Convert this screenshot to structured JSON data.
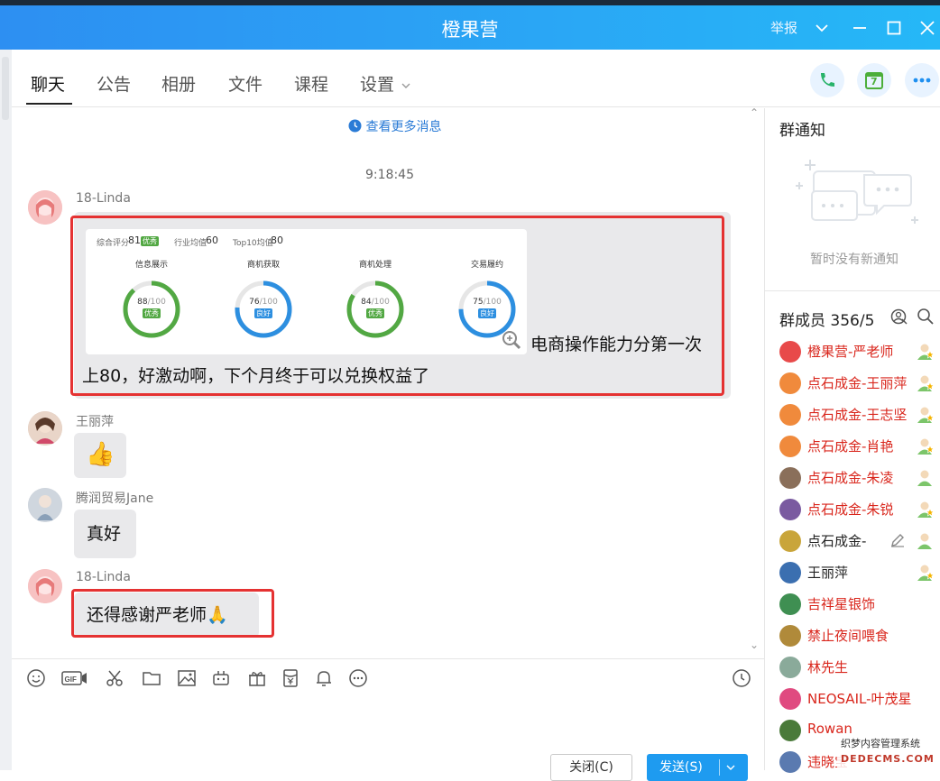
{
  "window": {
    "title": "橙果营",
    "report_label": "举报"
  },
  "tabs": [
    {
      "label": "聊天"
    },
    {
      "label": "公告"
    },
    {
      "label": "相册"
    },
    {
      "label": "文件"
    },
    {
      "label": "课程"
    },
    {
      "label": "设置"
    }
  ],
  "header_actions": {
    "calendar_day": "7"
  },
  "chat": {
    "more_messages": "查看更多消息",
    "timestamp": "9:18:45",
    "messages": [
      {
        "sender": "18-Linda",
        "text_line1": "电商操作能力分第一次",
        "text_line2": "上80，好激动啊，下个月终于可以兑换权益了",
        "screenshot": {
          "overall_label": "综合评分",
          "overall_value": "81",
          "overall_badge": "优秀",
          "industry_label": "行业均值",
          "industry_value": "60",
          "top10_label": "Top10均值",
          "top10_value": "80",
          "rings": [
            {
              "title": "信息展示",
              "score": "88",
              "max": "/100",
              "grade": "优秀",
              "color": "#52a843",
              "value": 88
            },
            {
              "title": "商机获取",
              "score": "76",
              "max": "/100",
              "grade": "良好",
              "color": "#2d8fe0",
              "value": 76
            },
            {
              "title": "商机处理",
              "score": "84",
              "max": "/100",
              "grade": "优秀",
              "color": "#52a843",
              "value": 84
            },
            {
              "title": "交易履约",
              "score": "75",
              "max": "/100",
              "grade": "良好",
              "color": "#2d8fe0",
              "value": 75
            }
          ]
        }
      },
      {
        "sender": "王丽萍",
        "emoji": "👍"
      },
      {
        "sender": "腾润贸易Jane",
        "text": "真好"
      },
      {
        "sender": "18-Linda",
        "text": "还得感谢严老师",
        "emoji": "🙏"
      }
    ]
  },
  "input": {
    "close_label": "关闭(C)",
    "send_label": "发送(S)"
  },
  "sidebar": {
    "notice_title": "群通知",
    "notice_empty": "暂时没有新通知",
    "members_title": "群成员 356/5",
    "members": [
      {
        "name": "橙果营-严老师",
        "color": "#d9261c",
        "avatar": "#e84a4a",
        "role": "gold"
      },
      {
        "name": "点石成金-王丽萍",
        "color": "#d9261c",
        "avatar": "#f08a3c",
        "role": "gold"
      },
      {
        "name": "点石成金-王志坚",
        "color": "#d9261c",
        "avatar": "#f08a3c",
        "role": "gold"
      },
      {
        "name": "点石成金-肖艳",
        "color": "#d9261c",
        "avatar": "#f08a3c",
        "role": "gold"
      },
      {
        "name": "点石成金-朱凌",
        "color": "#d9261c",
        "avatar": "#8a6f5a",
        "role": "green"
      },
      {
        "name": "点石成金-朱锐",
        "color": "#d9261c",
        "avatar": "#7a5aa0",
        "role": "gold"
      },
      {
        "name": "点石成金-",
        "color": "#222222",
        "avatar": "#c9a53a",
        "role": "green"
      },
      {
        "name": "王丽萍",
        "color": "#222222",
        "avatar": "#3b6fb0",
        "role": "gold"
      },
      {
        "name": "吉祥星银饰",
        "color": "#d9261c",
        "avatar": "#3f8f52",
        "role": ""
      },
      {
        "name": "禁止夜间喂食",
        "color": "#d9261c",
        "avatar": "#b08a3a",
        "role": ""
      },
      {
        "name": "林先生",
        "color": "#d9261c",
        "avatar": "#8aaa9a",
        "role": ""
      },
      {
        "name": "NEOSAIL-叶茂星",
        "color": "#d9261c",
        "avatar": "#e04a80",
        "role": ""
      },
      {
        "name": "Rowan",
        "color": "#d9261c",
        "avatar": "#4a7a3a",
        "role": ""
      },
      {
        "name": "违晓宝",
        "color": "#d9261c",
        "avatar": "#5a7ab0",
        "role": ""
      }
    ]
  },
  "watermark": {
    "line1": "织梦内容管理系统",
    "line2": "DEDECMS.COM"
  }
}
